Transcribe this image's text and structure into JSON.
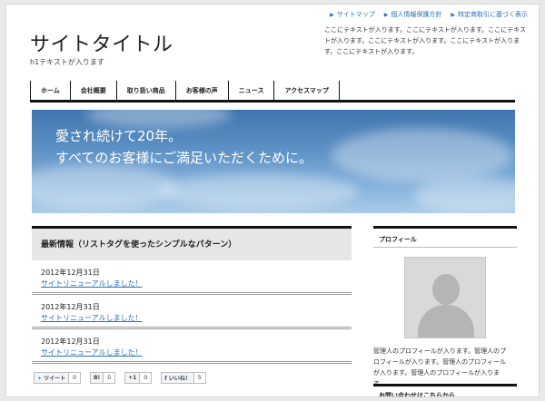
{
  "header": {
    "top_links": [
      "サイトマップ",
      "個人情報保護方針",
      "特定商取引に基づく表示"
    ],
    "site_title": "サイトタイトル",
    "h1_text": "h1テキストが入ります",
    "header_text": "ここにテキストが入ります。ここにテキストが入ります。ここにテキストが入ります。ここにテキストが入ります。ここにテキストが入ります。ここにテキストが入ります。"
  },
  "nav": {
    "items": [
      "ホーム",
      "会社概要",
      "取り扱い商品",
      "お客様の声",
      "ニュース",
      "アクセスマップ"
    ]
  },
  "hero": {
    "line1": "愛され続けて20年。",
    "line2": "すべてのお客様にご満足いただくために。"
  },
  "news": {
    "heading": "最新情報（リストタグを使ったシンプルなパターン）",
    "items": [
      {
        "date": "2012年12月31日",
        "title": "サイトリニューアルしました！"
      },
      {
        "date": "2012年12月31日",
        "title": "サイトリニューアルしました！"
      },
      {
        "date": "2012年12月31日",
        "title": "サイトリニューアルしました！"
      }
    ]
  },
  "social": {
    "tweet_label": "ツイート",
    "tweet_count": "0",
    "hatena_label": "B!",
    "hatena_count": "0",
    "gplus_label": "+1",
    "gplus_count": "0",
    "like_label": "いいね！",
    "like_count": "5"
  },
  "sidebar": {
    "profile_heading": "プロフィール",
    "profile_text": "管理人のプロフィールが入ります。管理人のプロフィールが入ります。管理人のプロフィールが入ります。管理人のプロフィールが入ります。",
    "contact_heading": "お問い合わせはこちらから"
  }
}
